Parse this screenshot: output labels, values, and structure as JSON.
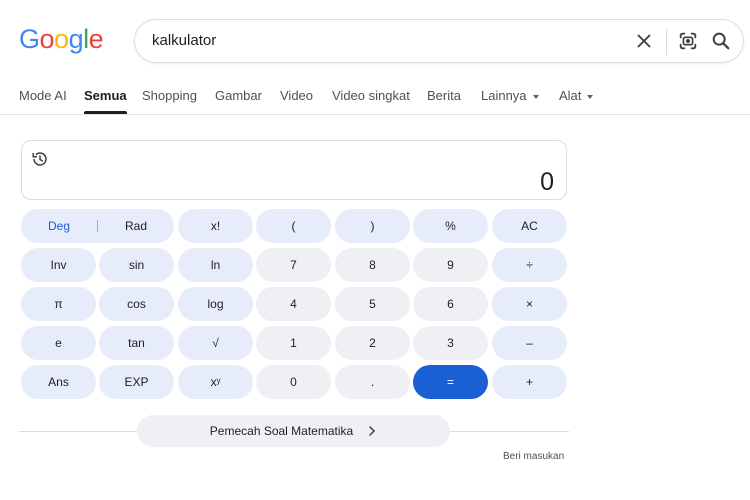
{
  "logo": {
    "letters": [
      "G",
      "o",
      "o",
      "g",
      "l",
      "e"
    ],
    "colors": [
      "#4285F4",
      "#EA4335",
      "#FBBC05",
      "#4285F4",
      "#34A853",
      "#EA4335"
    ]
  },
  "search": {
    "query": "kalkulator"
  },
  "tabs": [
    {
      "label": "Mode AI"
    },
    {
      "label": "Semua",
      "active": true
    },
    {
      "label": "Shopping"
    },
    {
      "label": "Gambar"
    },
    {
      "label": "Video"
    },
    {
      "label": "Video singkat"
    },
    {
      "label": "Berita"
    },
    {
      "label": "Lainnya",
      "dropdown": true
    },
    {
      "label": "Alat",
      "dropdown": true
    }
  ],
  "calculator": {
    "display": "0",
    "keys": {
      "deg": "Deg",
      "rad": "Rad",
      "fact": "x!",
      "lparen": "(",
      "rparen": ")",
      "percent": "%",
      "ac": "AC",
      "inv": "Inv",
      "sin": "sin",
      "ln": "ln",
      "n7": "7",
      "n8": "8",
      "n9": "9",
      "divide": "÷",
      "pi": "π",
      "cos": "cos",
      "log": "log",
      "n4": "4",
      "n5": "5",
      "n6": "6",
      "multiply": "×",
      "e": "e",
      "tan": "tan",
      "sqrt": "√",
      "n1": "1",
      "n2": "2",
      "n3": "3",
      "minus": "–",
      "ans": "Ans",
      "exp": "EXP",
      "pow": "xʸ",
      "n0": "0",
      "dot": ".",
      "equals": "=",
      "plus": "+"
    },
    "accent": "#1a5fd4"
  },
  "solver": {
    "label": "Pemecah Soal Matematika"
  },
  "feedback": {
    "label": "Beri masukan"
  }
}
